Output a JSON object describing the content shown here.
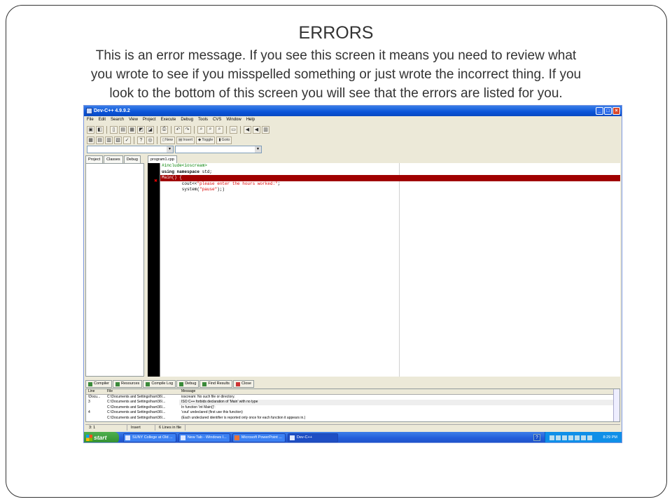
{
  "slide": {
    "title": "ERRORS",
    "body_lines": [
      "This is an error message. If you see this screen it means you need to review what",
      "you wrote to see if you misspelled something or just wrote the incorrect thing. If you",
      "look to the bottom of this screen you will see that the errors are listed for you."
    ]
  },
  "window": {
    "title": "Dev-C++ 4.9.9.2",
    "controls": [
      "_",
      "□",
      "×"
    ]
  },
  "menu": [
    "File",
    "Edit",
    "Search",
    "View",
    "Project",
    "Execute",
    "Debug",
    "Tools",
    "CVS",
    "Window",
    "Help"
  ],
  "toolbar2": {
    "new_label": "New",
    "insert_label": "Insert",
    "toggle_label": "Toggle",
    "goto_label": "Goto"
  },
  "left_tabs": [
    "Project",
    "Classes",
    "Debug"
  ],
  "editor": {
    "tab_label": "program1.cpp",
    "error_marker": "✖",
    "lines": {
      "l1": "#include<ioscream>",
      "l2_kw": "using namespace",
      "l2_rest": " std;",
      "l3": "Main() {",
      "l4_pre": "        cout<<",
      "l4_str": "\"please enter the hours worked:\"",
      "l4_post": ";",
      "l5_pre": "        system(",
      "l5_str": "\"pause\"",
      "l5_post": ");)"
    }
  },
  "bottom_tabs": [
    "Compiler",
    "Resources",
    "Compile Log",
    "Debug",
    "Find Results",
    "Close"
  ],
  "log": {
    "headers": {
      "line": "Line",
      "file": "File",
      "message": "Message"
    },
    "rows": [
      {
        "line": "\\Docu...",
        "file": "C:\\Documents and Settings\\harri36\\...",
        "message": "ioscream: No such file or directory."
      },
      {
        "line": "3",
        "file": "C:\\Documents and Settings\\harri36\\...",
        "message": "ISO C++ forbids declaration of 'Main' with no type"
      },
      {
        "line": "",
        "file": "C:\\Documents and Settings\\harri36\\...",
        "message": "In function 'int Main()':"
      },
      {
        "line": "4",
        "file": "C:\\Documents and Settings\\harri36\\...",
        "message": "'cout' undeclared (first use this function)"
      },
      {
        "line": "",
        "file": "C:\\Documents and Settings\\harri36\\...",
        "message": "(Each undeclared identifier is reported only once for each function it appears in.)"
      }
    ]
  },
  "status": {
    "position": "3: 1",
    "mode": "Insert",
    "lines_info": "6 Lines in file"
  },
  "taskbar": {
    "start_label": "start",
    "items": [
      "SUNY College at Old ...",
      "New Tab - Windows I...",
      "Microsoft PowerPoint ...",
      "Dev-C++"
    ],
    "clock": "8:29 PM"
  },
  "colors": {
    "error_line": "#a00000",
    "xp_blue": "#245edb"
  }
}
